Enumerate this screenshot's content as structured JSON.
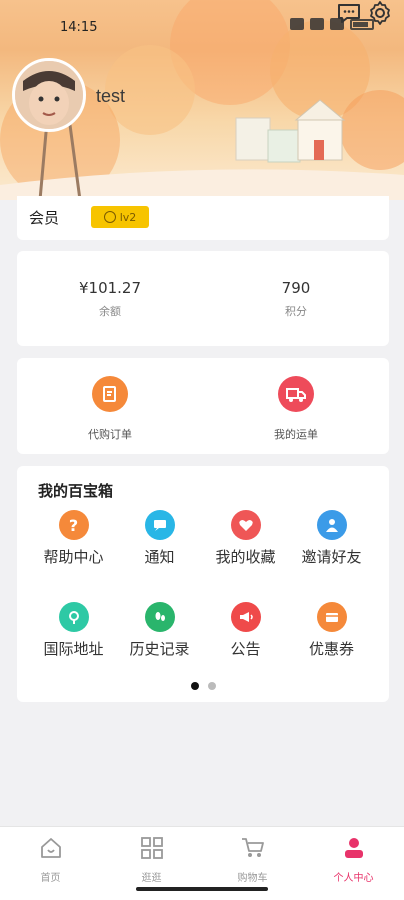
{
  "status": {
    "time": "14:15"
  },
  "profile": {
    "username": "test",
    "chat_icon": "chat-icon",
    "settings_icon": "gear-icon"
  },
  "member": {
    "label": "会员",
    "level": "lv2"
  },
  "stats": [
    {
      "value": "¥101.27",
      "label": "余额"
    },
    {
      "value": "790",
      "label": "积分"
    }
  ],
  "orders": [
    {
      "label": "代购订单",
      "icon": "order-icon",
      "color": "#f5893a"
    },
    {
      "label": "我的运单",
      "icon": "truck-icon",
      "color": "#ee4b5a"
    }
  ],
  "treasure": {
    "title": "我的百宝箱",
    "items": [
      {
        "label": "帮助中心",
        "icon": "help-icon",
        "color": "#f5893a"
      },
      {
        "label": "通知",
        "icon": "message-icon",
        "color": "#29b6e6"
      },
      {
        "label": "我的收藏",
        "icon": "heart-icon",
        "color": "#ef5656"
      },
      {
        "label": "邀请好友",
        "icon": "user-icon",
        "color": "#3b9be8"
      },
      {
        "label": "国际地址",
        "icon": "location-icon",
        "color": "#2ec9a5"
      },
      {
        "label": "历史记录",
        "icon": "footprint-icon",
        "color": "#2ab56c"
      },
      {
        "label": "公告",
        "icon": "megaphone-icon",
        "color": "#ef4a4a"
      },
      {
        "label": "优惠券",
        "icon": "coupon-icon",
        "color": "#f5893a"
      }
    ]
  },
  "tabs": [
    {
      "label": "首页",
      "icon": "home-icon"
    },
    {
      "label": "逛逛",
      "icon": "grid-icon"
    },
    {
      "label": "购物车",
      "icon": "cart-icon"
    },
    {
      "label": "个人中心",
      "icon": "person-icon"
    }
  ],
  "colors": {
    "accent": "#e8336a",
    "badge": "#f7c400"
  }
}
